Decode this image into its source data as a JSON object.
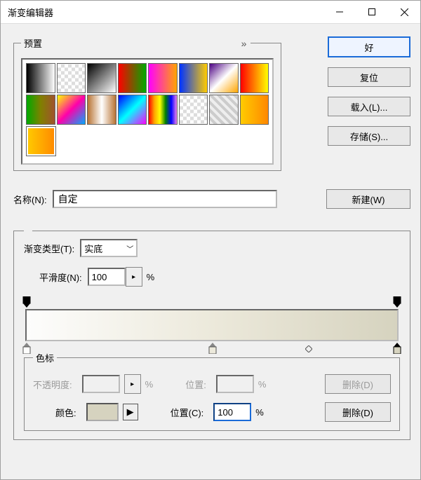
{
  "window": {
    "title": "渐变编辑器"
  },
  "presets": {
    "legend": "预置"
  },
  "buttons": {
    "ok": "好",
    "reset": "复位",
    "load": "载入(L)...",
    "save": "存储(S)...",
    "new": "新建(W)",
    "deleteOpacity": "删除(D)",
    "deleteColor": "删除(D)"
  },
  "name": {
    "label": "名称(N):",
    "value": "自定"
  },
  "gradient": {
    "typeLabel": "渐变类型(T):",
    "typeValue": "实底",
    "smoothLabel": "平滑度(N):",
    "smoothValue": "100",
    "percent": "%"
  },
  "stops": {
    "legend": "色标",
    "opacityLabel": "不透明度:",
    "opacityPercent": "%",
    "opacityLocLabel": "位置:",
    "opacityLocPercent": "%",
    "colorLabel": "颜色:",
    "colorLocLabel": "位置(C):",
    "colorLocValue": "100",
    "colorLocPercent": "%"
  }
}
